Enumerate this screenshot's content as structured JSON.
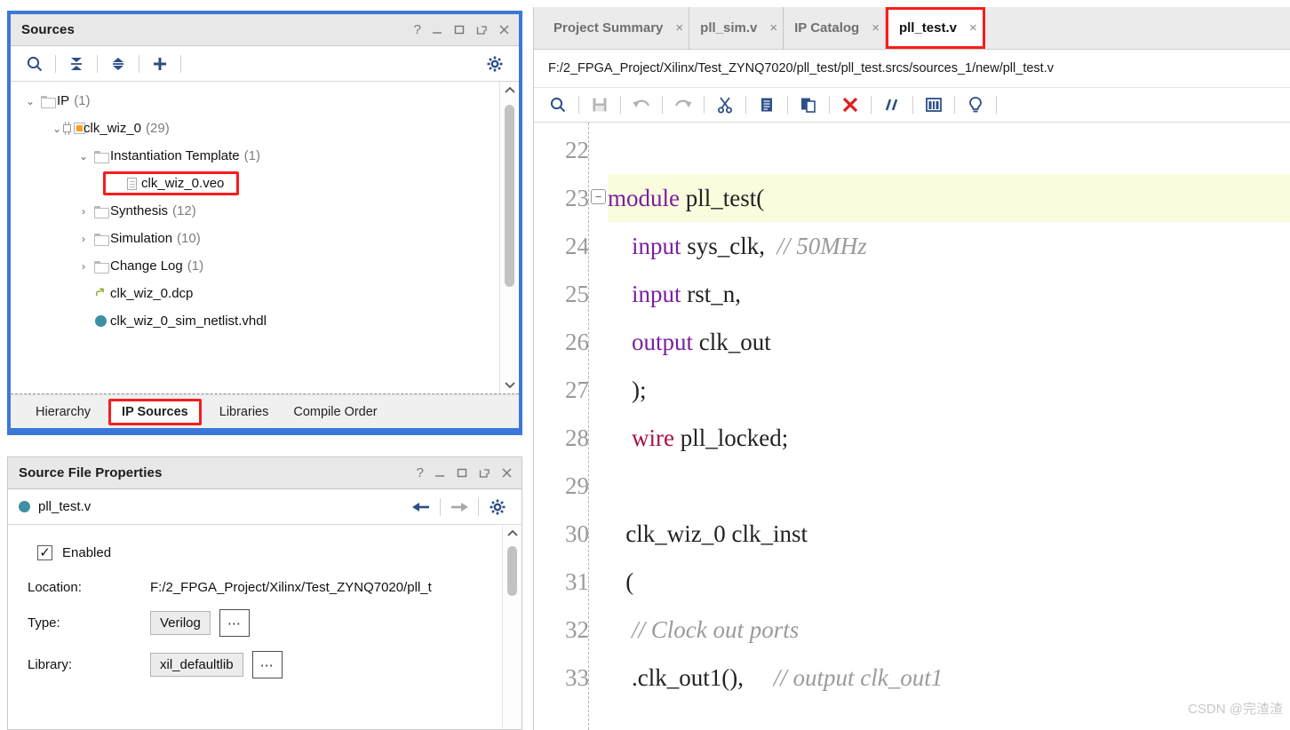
{
  "sources_panel": {
    "title": "Sources",
    "window_controls": [
      "?",
      "_",
      "□",
      "↗",
      "✕"
    ],
    "toolbar": {
      "search": "search-icon",
      "collapse_all": "collapse-all-icon",
      "expand_all": "expand-all-icon",
      "add_sources": "add-sources-icon",
      "settings": "gear-icon"
    },
    "tree": [
      {
        "label": "IP",
        "count": "(1)",
        "indent": 0,
        "icon": "folder",
        "expanded": true,
        "highlighted": false
      },
      {
        "label": "clk_wiz_0",
        "count": "(29)",
        "indent": 1,
        "icon": "ip",
        "expanded": true,
        "highlighted": false
      },
      {
        "label": "Instantiation Template",
        "count": "(1)",
        "indent": 2,
        "icon": "folder",
        "expanded": true,
        "highlighted": false
      },
      {
        "label": "clk_wiz_0.veo",
        "count": "",
        "indent": 3,
        "icon": "file",
        "expanded": null,
        "highlighted": true
      },
      {
        "label": "Synthesis",
        "count": "(12)",
        "indent": 2,
        "icon": "folder",
        "expanded": false,
        "highlighted": false
      },
      {
        "label": "Simulation",
        "count": "(10)",
        "indent": 2,
        "icon": "folder",
        "expanded": false,
        "highlighted": false
      },
      {
        "label": "Change Log",
        "count": "(1)",
        "indent": 2,
        "icon": "folder",
        "expanded": false,
        "highlighted": false
      },
      {
        "label": "clk_wiz_0.dcp",
        "count": "",
        "indent": 2,
        "icon": "dcp",
        "expanded": null,
        "highlighted": false
      },
      {
        "label": "clk_wiz_0_sim_netlist.vhdl",
        "count": "",
        "indent": 2,
        "icon": "circle",
        "expanded": null,
        "highlighted": false
      }
    ],
    "tabs": [
      {
        "label": "Hierarchy",
        "active": false,
        "highlighted": false
      },
      {
        "label": "IP Sources",
        "active": true,
        "highlighted": true
      },
      {
        "label": "Libraries",
        "active": false,
        "highlighted": false
      },
      {
        "label": "Compile Order",
        "active": false,
        "highlighted": false
      }
    ]
  },
  "properties_panel": {
    "title": "Source File Properties",
    "window_controls": [
      "?",
      "_",
      "□",
      "↗",
      "✕"
    ],
    "file_name": "pll_test.v",
    "nav": {
      "back": "back-arrow-icon",
      "forward": "forward-arrow-icon",
      "settings": "gear-icon"
    },
    "enabled_label": "Enabled",
    "enabled_checked": true,
    "fields": [
      {
        "label": "Location:",
        "value": "F:/2_FPGA_Project/Xilinx/Test_ZYNQ7020/pll_t",
        "kind": "text"
      },
      {
        "label": "Type:",
        "value": "Verilog",
        "kind": "combo",
        "dots": "⋯"
      },
      {
        "label": "Library:",
        "value": "xil_defaultlib",
        "kind": "combo",
        "dots": "⋯"
      }
    ]
  },
  "editor": {
    "tabs": [
      {
        "label": "Project Summary",
        "close": "×",
        "active": false,
        "highlighted": false
      },
      {
        "label": "pll_sim.v",
        "close": "×",
        "active": false,
        "highlighted": false
      },
      {
        "label": "IP Catalog",
        "close": "×",
        "active": false,
        "highlighted": false
      },
      {
        "label": "pll_test.v",
        "close": "×",
        "active": true,
        "highlighted": true
      }
    ],
    "file_path": "F:/2_FPGA_Project/Xilinx/Test_ZYNQ7020/pll_test/pll_test.srcs/sources_1/new/pll_test.v",
    "toolbar": [
      {
        "name": "search-icon",
        "enabled": true
      },
      {
        "name": "save-icon",
        "enabled": false
      },
      {
        "name": "undo-icon",
        "enabled": false
      },
      {
        "name": "redo-icon",
        "enabled": false
      },
      {
        "name": "cut-icon",
        "enabled": true
      },
      {
        "name": "copy-icon",
        "enabled": true
      },
      {
        "name": "paste-icon",
        "enabled": true
      },
      {
        "name": "delete-icon",
        "enabled": true
      },
      {
        "name": "comment-icon",
        "enabled": true
      },
      {
        "name": "columns-icon",
        "enabled": true
      },
      {
        "name": "lightbulb-icon",
        "enabled": true
      }
    ],
    "first_line_number": 22,
    "lines": [
      {
        "n": "22",
        "fold": false,
        "highlight": false,
        "tokens": []
      },
      {
        "n": "23",
        "fold": true,
        "highlight": true,
        "tokens": [
          {
            "t": "module",
            "c": "kw"
          },
          {
            "t": " pll_test(",
            "c": ""
          }
        ]
      },
      {
        "n": "24",
        "fold": false,
        "highlight": false,
        "tokens": [
          {
            "t": "    ",
            "c": ""
          },
          {
            "t": "input",
            "c": "kw"
          },
          {
            "t": " sys_clk,  ",
            "c": ""
          },
          {
            "t": "// 50MHz",
            "c": "cmt"
          }
        ]
      },
      {
        "n": "25",
        "fold": false,
        "highlight": false,
        "tokens": [
          {
            "t": "    ",
            "c": ""
          },
          {
            "t": "input",
            "c": "kw"
          },
          {
            "t": " rst_n,",
            "c": ""
          }
        ]
      },
      {
        "n": "26",
        "fold": false,
        "highlight": false,
        "tokens": [
          {
            "t": "    ",
            "c": ""
          },
          {
            "t": "output",
            "c": "kw"
          },
          {
            "t": " clk_out",
            "c": ""
          }
        ]
      },
      {
        "n": "27",
        "fold": false,
        "highlight": false,
        "tokens": [
          {
            "t": "    );",
            "c": ""
          }
        ]
      },
      {
        "n": "28",
        "fold": false,
        "highlight": false,
        "tokens": [
          {
            "t": "    ",
            "c": ""
          },
          {
            "t": "wire",
            "c": "kw2"
          },
          {
            "t": " pll_locked;",
            "c": ""
          }
        ]
      },
      {
        "n": "29",
        "fold": false,
        "highlight": false,
        "tokens": []
      },
      {
        "n": "30",
        "fold": false,
        "highlight": false,
        "tokens": [
          {
            "t": "   clk_wiz_0 clk_inst",
            "c": ""
          }
        ]
      },
      {
        "n": "31",
        "fold": false,
        "highlight": false,
        "tokens": [
          {
            "t": "   (",
            "c": ""
          }
        ]
      },
      {
        "n": "32",
        "fold": false,
        "highlight": false,
        "tokens": [
          {
            "t": "    ",
            "c": ""
          },
          {
            "t": "// Clock out ports",
            "c": "cmt"
          }
        ]
      },
      {
        "n": "33",
        "fold": false,
        "highlight": false,
        "tokens": [
          {
            "t": "    .clk_out1(),     ",
            "c": ""
          },
          {
            "t": "// output clk_out1",
            "c": "cmt"
          }
        ]
      }
    ],
    "watermark": "CSDN @完渣渣"
  },
  "colors": {
    "panel_focus_border": "#3b78d8",
    "highlight_red": "#fb1b1b",
    "keyword_purple": "#7a1fa2",
    "keyword_crimson": "#a61243",
    "comment_gray": "#9a9a9a",
    "code_highlight_bg": "#fbfbdd",
    "ip_orange": "#f5a21f",
    "circle_teal": "#3e8fa5",
    "icon_blue": "#2c4f86"
  }
}
